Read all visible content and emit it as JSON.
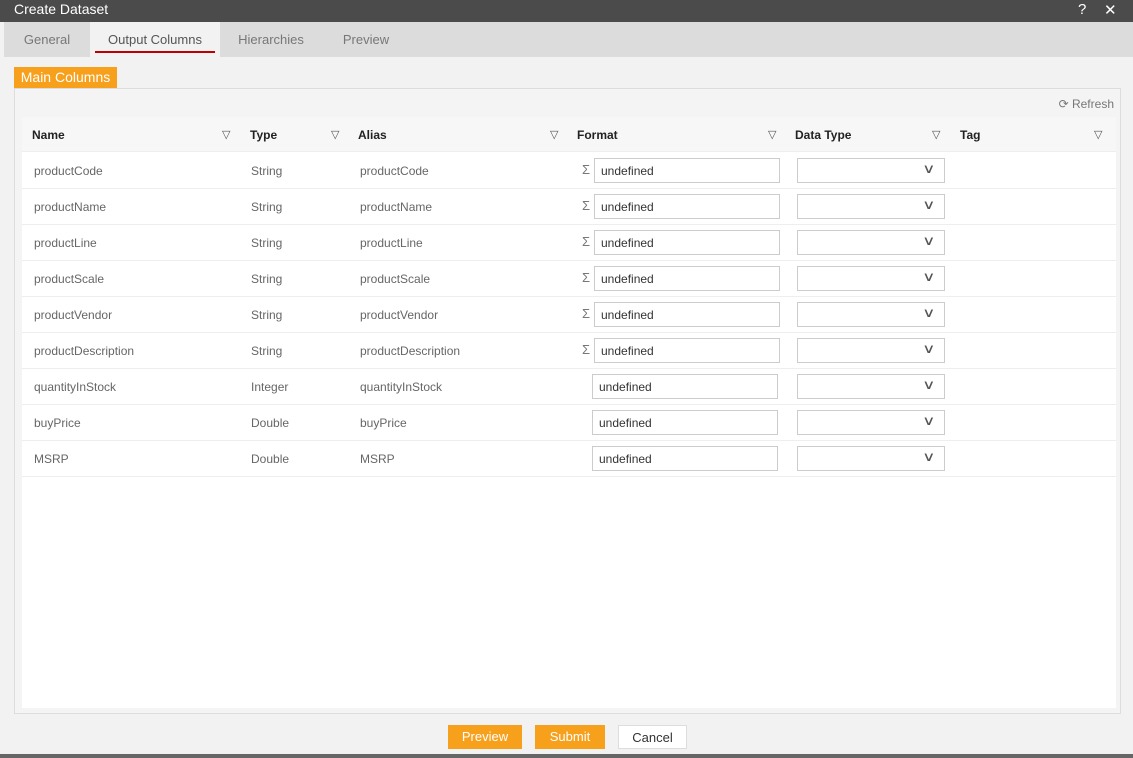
{
  "window": {
    "title": "Create Dataset",
    "help": "?",
    "close": "✕"
  },
  "tabs": [
    {
      "label": "General"
    },
    {
      "label": "Output Columns",
      "active": true
    },
    {
      "label": "Hierarchies"
    },
    {
      "label": "Preview"
    }
  ],
  "subtab": "Main Columns",
  "refresh": "Refresh",
  "columns": [
    "Name",
    "Type",
    "Alias",
    "Format",
    "Data Type",
    "Tag"
  ],
  "rows": [
    {
      "name": "productCode",
      "type": "String",
      "alias": "productCode",
      "format": "undefined",
      "sigma": true
    },
    {
      "name": "productName",
      "type": "String",
      "alias": "productName",
      "format": "undefined",
      "sigma": true
    },
    {
      "name": "productLine",
      "type": "String",
      "alias": "productLine",
      "format": "undefined",
      "sigma": true
    },
    {
      "name": "productScale",
      "type": "String",
      "alias": "productScale",
      "format": "undefined",
      "sigma": true
    },
    {
      "name": "productVendor",
      "type": "String",
      "alias": "productVendor",
      "format": "undefined",
      "sigma": true
    },
    {
      "name": "productDescription",
      "type": "String",
      "alias": "productDescription",
      "format": "undefined",
      "sigma": true
    },
    {
      "name": "quantityInStock",
      "type": "Integer",
      "alias": "quantityInStock",
      "format": "undefined",
      "sigma": false
    },
    {
      "name": "buyPrice",
      "type": "Double",
      "alias": "buyPrice",
      "format": "undefined",
      "sigma": false
    },
    {
      "name": "MSRP",
      "type": "Double",
      "alias": "MSRP",
      "format": "undefined",
      "sigma": false
    }
  ],
  "buttons": {
    "preview": "Preview",
    "submit": "Submit",
    "cancel": "Cancel"
  },
  "colors": {
    "accent": "#f7a01c",
    "active_tab_underline": "#c00000",
    "titlebar": "#4b4b4b"
  }
}
